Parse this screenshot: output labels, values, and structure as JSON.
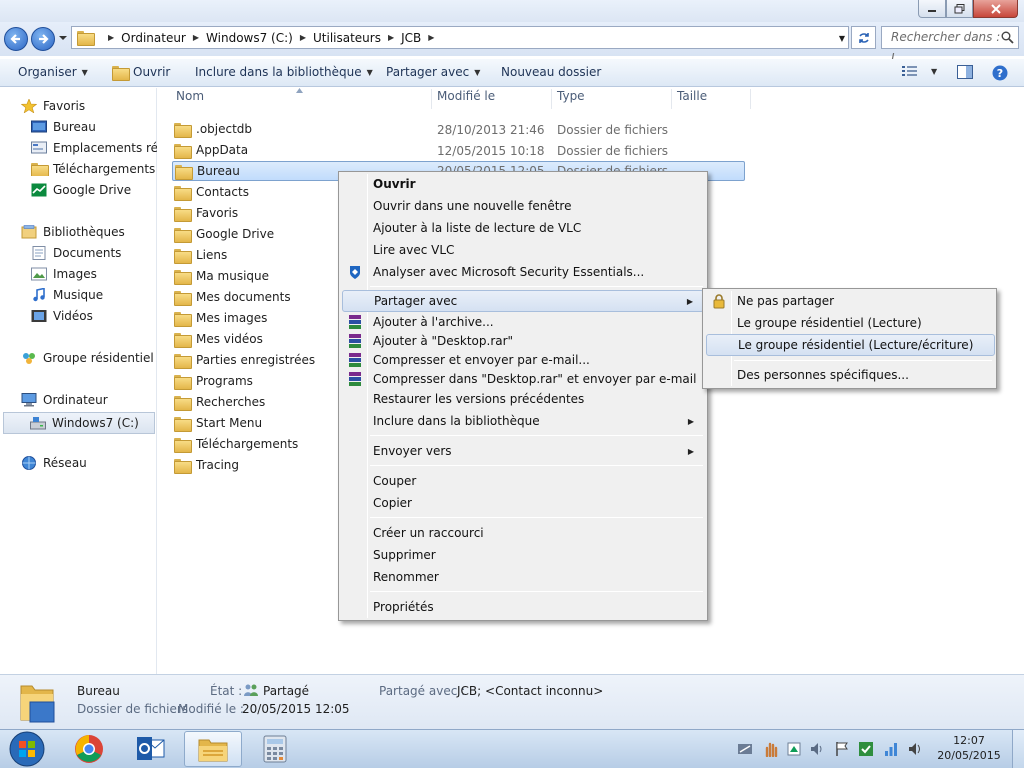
{
  "address": {
    "crumbs": [
      "Ordinateur",
      "Windows7 (C:)",
      "Utilisateurs",
      "JCB"
    ],
    "search_placeholder": "Rechercher dans : J..."
  },
  "toolbar": {
    "organiser": "Organiser",
    "ouvrir": "Ouvrir",
    "inclure": "Inclure dans la bibliothèque",
    "partager": "Partager avec",
    "nouveau_dossier": "Nouveau dossier"
  },
  "nav": {
    "favoris": "Favoris",
    "bureau": "Bureau",
    "emplacements": "Emplacements récer",
    "telechargements": "Téléchargements",
    "google_drive": "Google Drive",
    "bibliotheques": "Bibliothèques",
    "documents": "Documents",
    "images": "Images",
    "musique": "Musique",
    "videos": "Vidéos",
    "groupe": "Groupe résidentiel",
    "ordinateur": "Ordinateur",
    "windows7": "Windows7 (C:)",
    "reseau": "Réseau"
  },
  "columns": {
    "nom": "Nom",
    "modifie": "Modifié le",
    "type": "Type",
    "taille": "Taille"
  },
  "files": [
    {
      "name": ".objectdb",
      "date": "28/10/2013 21:46",
      "type": "Dossier de fichiers"
    },
    {
      "name": "AppData",
      "date": "12/05/2015 10:18",
      "type": "Dossier de fichiers"
    },
    {
      "name": "Bureau",
      "date": "20/05/2015 12:05",
      "type": "Dossier de fichiers"
    },
    {
      "name": "Contacts",
      "date": "",
      "type": ""
    },
    {
      "name": "Favoris",
      "date": "",
      "type": ""
    },
    {
      "name": "Google Drive",
      "date": "",
      "type": ""
    },
    {
      "name": "Liens",
      "date": "",
      "type": ""
    },
    {
      "name": "Ma musique",
      "date": "",
      "type": ""
    },
    {
      "name": "Mes documents",
      "date": "",
      "type": ""
    },
    {
      "name": "Mes images",
      "date": "",
      "type": ""
    },
    {
      "name": "Mes vidéos",
      "date": "",
      "type": ""
    },
    {
      "name": "Parties enregistrées",
      "date": "",
      "type": ""
    },
    {
      "name": "Programs",
      "date": "",
      "type": ""
    },
    {
      "name": "Recherches",
      "date": "",
      "type": ""
    },
    {
      "name": "Start Menu",
      "date": "",
      "type": ""
    },
    {
      "name": "Téléchargements",
      "date": "",
      "type": ""
    },
    {
      "name": "Tracing",
      "date": "",
      "type": ""
    }
  ],
  "menu": {
    "ouvrir": "Ouvrir",
    "nouvelle_fenetre": "Ouvrir dans une nouvelle fenêtre",
    "vlc_liste": "Ajouter à la liste de lecture de VLC",
    "vlc_lire": "Lire avec VLC",
    "mse": "Analyser avec Microsoft Security Essentials...",
    "partager": "Partager avec",
    "archive": "Ajouter à l'archive...",
    "desktop_rar": "Ajouter à \"Desktop.rar\"",
    "compresser_email": "Compresser et envoyer par e-mail...",
    "compresser_desktop": "Compresser dans \"Desktop.rar\" et envoyer par e-mail",
    "restaurer": "Restaurer les versions précédentes",
    "inclure": "Inclure dans la bibliothèque",
    "envoyer": "Envoyer vers",
    "couper": "Couper",
    "copier": "Copier",
    "raccourci": "Créer un raccourci",
    "supprimer": "Supprimer",
    "renommer": "Renommer",
    "proprietes": "Propriétés"
  },
  "submenu": {
    "ne_pas": "Ne pas partager",
    "lecture": "Le groupe résidentiel (Lecture)",
    "lecture_ecriture": "Le groupe résidentiel (Lecture/écriture)",
    "specifiques": "Des personnes spécifiques..."
  },
  "details": {
    "name": "Bureau",
    "kind": "Dossier de fichiers",
    "etat_label": "État :",
    "etat_value": "Partagé",
    "modifie_label": "Modifié le :",
    "modifie_value": "20/05/2015 12:05",
    "partage_label": "Partagé avec :",
    "partage_value": "JCB; <Contact inconnu>"
  },
  "clock": {
    "time": "12:07",
    "date": "20/05/2015"
  },
  "colors": {
    "selection": "#c1dcfc",
    "menu_bg": "#f0f0f0",
    "taskbar": "#b7cde6"
  }
}
